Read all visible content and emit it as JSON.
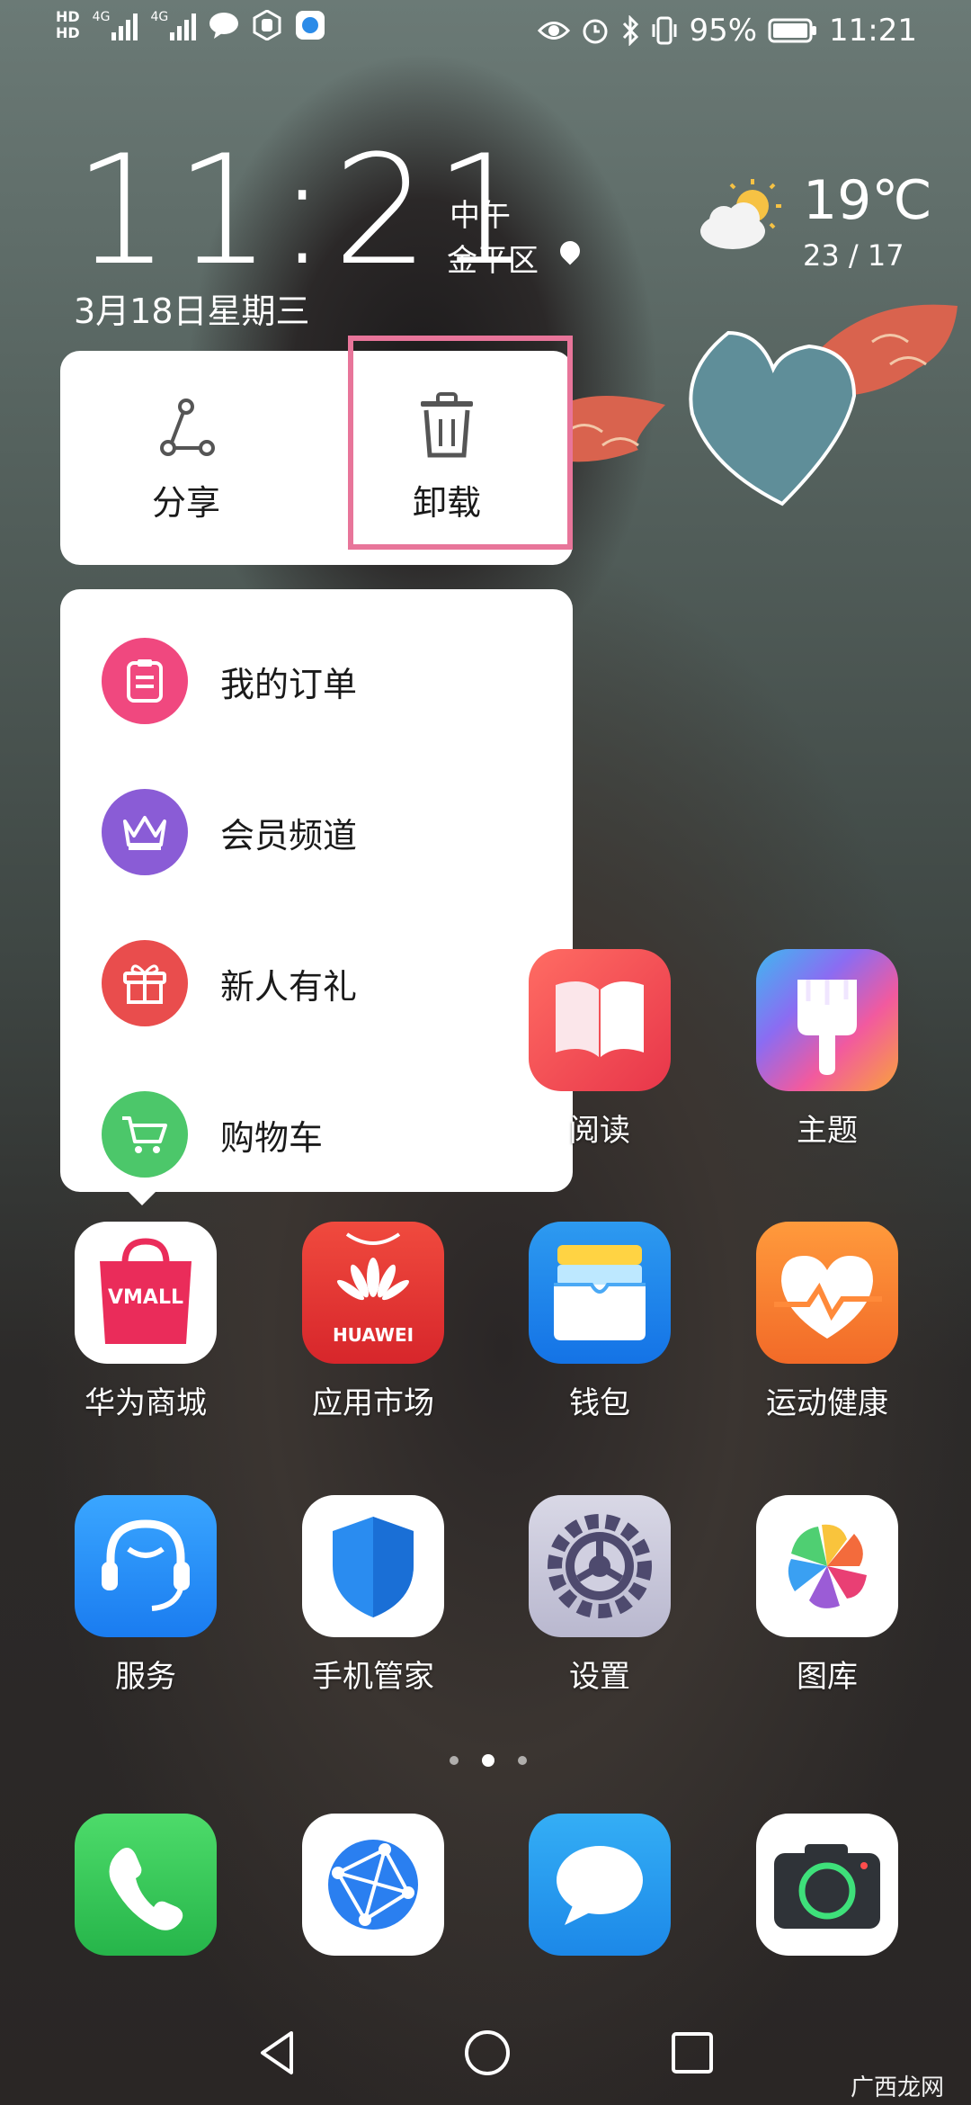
{
  "status_bar": {
    "hd1": "HD",
    "hd2": "HD",
    "sig1_label": "4G",
    "sig2_label": "4G",
    "battery": "95%",
    "time": "11:21"
  },
  "clock_widget": {
    "time": "11:21",
    "period": "中午",
    "location": "金平区",
    "date": "3月18日星期三",
    "temperature": "19℃",
    "temp_range": "23 / 17"
  },
  "context_menu": {
    "actions": [
      {
        "label": "分享",
        "icon": "share-icon"
      },
      {
        "label": "卸载",
        "icon": "trash-icon"
      }
    ],
    "shortcuts": [
      {
        "label": "我的订单",
        "icon": "order-icon",
        "color": "#f0487f"
      },
      {
        "label": "会员频道",
        "icon": "crown-icon",
        "color": "#8a5cd6"
      },
      {
        "label": "新人有礼",
        "icon": "gift-icon",
        "color": "#e94d4d"
      },
      {
        "label": "购物车",
        "icon": "cart-icon",
        "color": "#4cc76a"
      }
    ]
  },
  "apps": {
    "row1": [
      {
        "label": "阅读",
        "icon": "book-icon"
      },
      {
        "label": "主题",
        "icon": "brush-icon"
      }
    ],
    "row2": [
      {
        "label": "华为商城",
        "icon": "vmall-icon",
        "badge": "VMALL"
      },
      {
        "label": "应用市场",
        "icon": "huawei-appgallery-icon",
        "badge": "HUAWEI"
      },
      {
        "label": "钱包",
        "icon": "wallet-icon"
      },
      {
        "label": "运动健康",
        "icon": "health-heart-icon"
      }
    ],
    "row3": [
      {
        "label": "服务",
        "icon": "service-headset-icon"
      },
      {
        "label": "手机管家",
        "icon": "shield-icon"
      },
      {
        "label": "设置",
        "icon": "gear-icon"
      },
      {
        "label": "图库",
        "icon": "gallery-pinwheel-icon"
      }
    ],
    "dock": [
      {
        "icon": "phone-icon"
      },
      {
        "icon": "browser-icon"
      },
      {
        "icon": "messages-icon"
      },
      {
        "icon": "camera-icon"
      }
    ]
  },
  "watermark": "广西龙网"
}
